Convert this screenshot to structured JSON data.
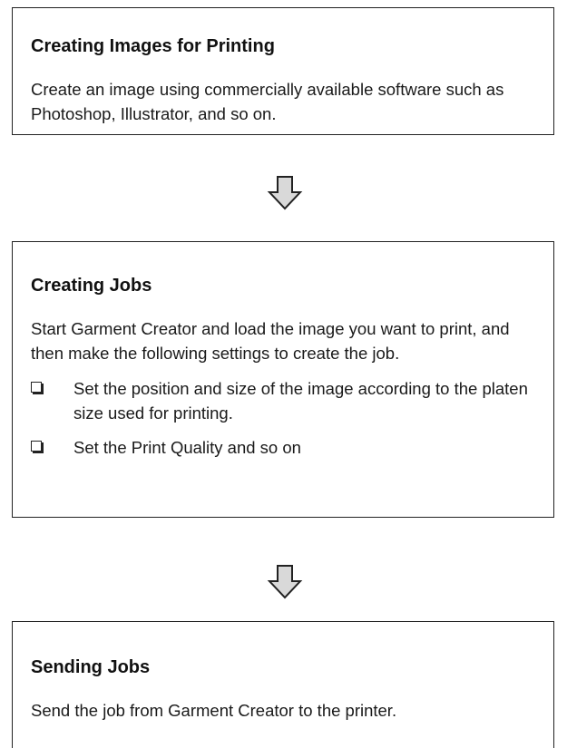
{
  "steps": [
    {
      "title": "Creating Images for Printing",
      "description": "Create an image using commercially available software such as Photoshop, Illustrator, and so on."
    },
    {
      "title": "Creating Jobs",
      "description": "Start Garment Creator and load the image you want to print, and then make the following settings to create the job.",
      "items": [
        "Set the position and size of the image according to the platen size used for printing.",
        "Set the Print Quality and so on"
      ]
    },
    {
      "title": "Sending Jobs",
      "description": "Send the job from Garment Creator to the printer."
    }
  ],
  "arrow_icon": "down-arrow-outline-icon",
  "colors": {
    "text": "#1a1a1a",
    "border": "#222222",
    "arrow_fill": "#d9d9d9"
  }
}
